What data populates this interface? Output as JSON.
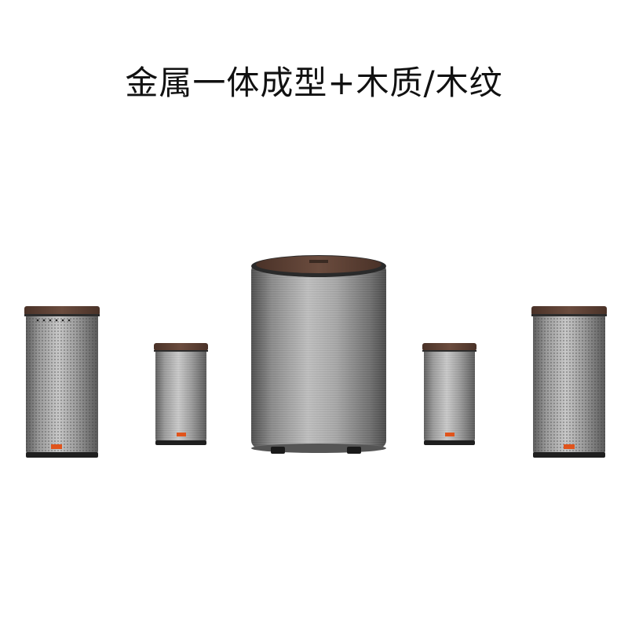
{
  "headline": "金属一体成型+木质/木纹",
  "colors": {
    "background": "#ffffff",
    "metal_dark": "#6b6b6b",
    "metal_light": "#c9c9c9",
    "wood": "#5a4034",
    "badge": "#e0541c"
  },
  "product_items": [
    {
      "name": "left-tower-speaker",
      "shape": "rectangular",
      "top": "walnut-wood",
      "finish": "perforated-grille",
      "has_control_panel": true
    },
    {
      "name": "left-satellite-speaker",
      "shape": "rectangular",
      "top": "walnut-wood",
      "finish": "brushed-metal"
    },
    {
      "name": "center-subwoofer",
      "shape": "cylinder",
      "top": "walnut-wood",
      "finish": "brushed-metal"
    },
    {
      "name": "right-satellite-speaker",
      "shape": "rectangular",
      "top": "walnut-wood",
      "finish": "brushed-metal"
    },
    {
      "name": "right-tower-speaker",
      "shape": "rectangular",
      "top": "walnut-wood",
      "finish": "perforated-grille"
    }
  ]
}
